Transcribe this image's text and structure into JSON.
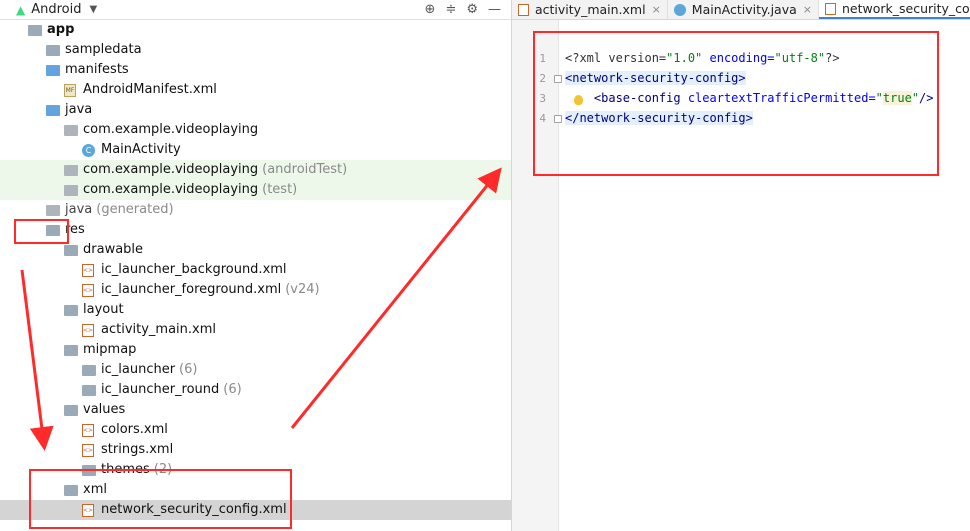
{
  "project_panel": {
    "view_mode": "Android",
    "tools": [
      "⊕",
      "≑",
      "⚙",
      "—"
    ]
  },
  "tree": [
    {
      "label": "app",
      "suffix": "",
      "depth": 0,
      "arrow": "▼",
      "icon": "module",
      "bold": true
    },
    {
      "label": "sampledata",
      "suffix": "",
      "depth": 1,
      "arrow": "",
      "icon": "folder"
    },
    {
      "label": "manifests",
      "suffix": "",
      "depth": 1,
      "arrow": "▼",
      "icon": "folder-blue"
    },
    {
      "label": "AndroidManifest.xml",
      "suffix": "",
      "depth": 2,
      "arrow": "",
      "icon": "manifest"
    },
    {
      "label": "java",
      "suffix": "",
      "depth": 1,
      "arrow": "▼",
      "icon": "folder-blue"
    },
    {
      "label": "com.example.videoplaying",
      "suffix": "",
      "depth": 2,
      "arrow": "▼",
      "icon": "package"
    },
    {
      "label": "MainActivity",
      "suffix": "",
      "depth": 3,
      "arrow": "",
      "icon": "class"
    },
    {
      "label": "com.example.videoplaying",
      "suffix": "(androidTest)",
      "depth": 2,
      "arrow": "▶",
      "icon": "package",
      "hl": true
    },
    {
      "label": "com.example.videoplaying",
      "suffix": "(test)",
      "depth": 2,
      "arrow": "▶",
      "icon": "package",
      "hl": true
    },
    {
      "label": "java",
      "suffix": "(generated)",
      "depth": 1,
      "arrow": "▶",
      "icon": "folder-gray",
      "muted": true
    },
    {
      "label": "res",
      "suffix": "",
      "depth": 1,
      "arrow": "▼",
      "icon": "folder-res"
    },
    {
      "label": "drawable",
      "suffix": "",
      "depth": 2,
      "arrow": "▼",
      "icon": "folder"
    },
    {
      "label": "ic_launcher_background.xml",
      "suffix": "",
      "depth": 3,
      "arrow": "",
      "icon": "xml"
    },
    {
      "label": "ic_launcher_foreground.xml",
      "suffix": "(v24)",
      "depth": 3,
      "arrow": "",
      "icon": "xml"
    },
    {
      "label": "layout",
      "suffix": "",
      "depth": 2,
      "arrow": "▼",
      "icon": "folder"
    },
    {
      "label": "activity_main.xml",
      "suffix": "",
      "depth": 3,
      "arrow": "",
      "icon": "xml"
    },
    {
      "label": "mipmap",
      "suffix": "",
      "depth": 2,
      "arrow": "▼",
      "icon": "folder"
    },
    {
      "label": "ic_launcher",
      "suffix": "(6)",
      "depth": 3,
      "arrow": "▶",
      "icon": "folder"
    },
    {
      "label": "ic_launcher_round",
      "suffix": "(6)",
      "depth": 3,
      "arrow": "▶",
      "icon": "folder"
    },
    {
      "label": "values",
      "suffix": "",
      "depth": 2,
      "arrow": "▼",
      "icon": "folder"
    },
    {
      "label": "colors.xml",
      "suffix": "",
      "depth": 3,
      "arrow": "",
      "icon": "xml"
    },
    {
      "label": "strings.xml",
      "suffix": "",
      "depth": 3,
      "arrow": "",
      "icon": "xml"
    },
    {
      "label": "themes",
      "suffix": "(2)",
      "depth": 3,
      "arrow": "▶",
      "icon": "folder"
    },
    {
      "label": "xml",
      "suffix": "",
      "depth": 2,
      "arrow": "▼",
      "icon": "folder"
    },
    {
      "label": "network_security_config.xml",
      "suffix": "",
      "depth": 3,
      "arrow": "",
      "icon": "xml",
      "selected": true
    }
  ],
  "editor": {
    "tabs": [
      {
        "label": "activity_main.xml",
        "icon": "xml",
        "active": false
      },
      {
        "label": "MainActivity.java",
        "icon": "class",
        "active": false
      },
      {
        "label": "network_security_config.",
        "icon": "xml",
        "active": true
      }
    ],
    "tab_close": "×",
    "line_numbers": [
      "1",
      "2",
      "3",
      "4"
    ],
    "lines": [
      {
        "parts": [
          {
            "t": "<?xml version=",
            "c": "t-pi"
          },
          {
            "t": "\"1.0\"",
            "c": "t-val"
          },
          {
            "t": " encoding=",
            "c": "t-attr"
          },
          {
            "t": "\"utf-8\"",
            "c": "t-val"
          },
          {
            "t": "?>",
            "c": "t-pi"
          }
        ]
      },
      {
        "parts": [
          {
            "t": "<network-security-config>",
            "c": "t-tag hlt"
          }
        ]
      },
      {
        "parts": [
          {
            "t": "    <base-config ",
            "c": "t-tag"
          },
          {
            "t": "cleartextTrafficPermitted=",
            "c": "t-attr"
          },
          {
            "t": "\"",
            "c": "t-val"
          },
          {
            "t": "true",
            "c": "t-val val-hl"
          },
          {
            "t": "\"",
            "c": "t-val"
          },
          {
            "t": "/>",
            "c": "t-tag"
          }
        ]
      },
      {
        "parts": [
          {
            "t": "</network-security-config>",
            "c": "t-tag hlt"
          }
        ]
      }
    ]
  },
  "colors": {
    "annotation": "#ff2a2a",
    "selection": "#d4d4d4",
    "test_highlight": "#edf8ea"
  }
}
